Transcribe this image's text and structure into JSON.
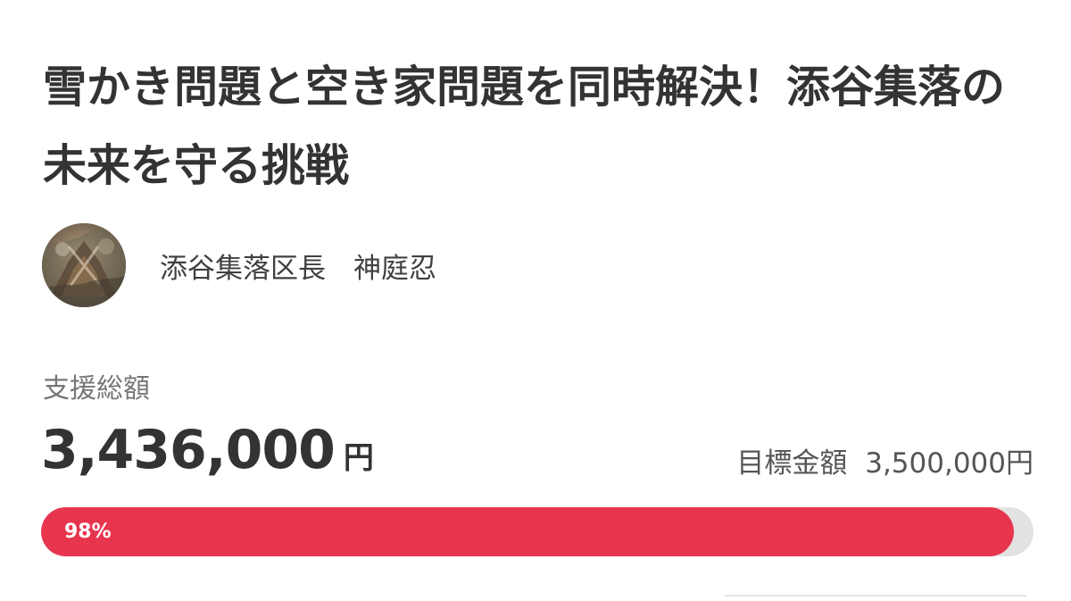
{
  "project": {
    "title": "雪かき問題と空き家問題を同時解決！添谷集落の未来を守る挑戦"
  },
  "owner": {
    "name": "添谷集落区長　神庭忍"
  },
  "funding": {
    "total_label": "支援総額",
    "amount": "3,436,000",
    "unit": "円",
    "goal_label": "目標金額",
    "goal_amount": "3,500,000円",
    "percent_text": "98%",
    "percent_value": 98
  },
  "colors": {
    "accent": "#e8354e",
    "track": "#e2e2e2"
  },
  "icons": {
    "avatar": "owner-avatar-image"
  }
}
